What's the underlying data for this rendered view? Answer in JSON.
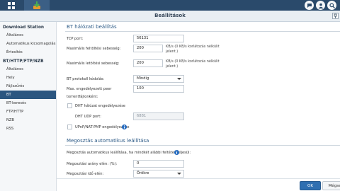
{
  "topbar": {
    "apps": [
      {
        "icon": "main-menu-grid-icon"
      },
      {
        "icon": "download-station-app-icon"
      }
    ],
    "right_icons": [
      "chat-icon",
      "user-icon",
      "search-icon"
    ]
  },
  "window": {
    "title": "Beállítások",
    "pin_icon": "pin-icon"
  },
  "sidebar": {
    "groups": [
      {
        "header": "Download Station",
        "items": [
          {
            "label": "Általános"
          },
          {
            "label": "Automatikus kicsomagolás"
          },
          {
            "label": "Értesítés"
          }
        ]
      },
      {
        "header": "BT/HTTP/FTP/NZB",
        "items": [
          {
            "label": "Általános"
          },
          {
            "label": "Hely"
          },
          {
            "label": "Fájlszűrés"
          },
          {
            "label": "BT",
            "active": true
          },
          {
            "label": "BT-keresés"
          },
          {
            "label": "FTP/HTTP"
          },
          {
            "label": "NZB"
          },
          {
            "label": "RSS"
          }
        ]
      }
    ]
  },
  "bt_section": {
    "title": "BT hálózati beállítás",
    "tcp_port": {
      "label": "TCP port:",
      "value": "56131"
    },
    "upload": {
      "label": "Maximális feltöltési sebesség:",
      "value": "200",
      "hint": "KB/s (0 KB/s korlátozás nélkülit jelent.)"
    },
    "download": {
      "label": "Maximális letöltési sebesség:",
      "value": "200",
      "hint": "KB/s (0 KB/s korlátozás nélkülit jelent.)"
    },
    "protocol": {
      "label": "BT protokoll kódolás:",
      "value": "Mindig"
    },
    "max_peers": {
      "label": "Max. engedélyezett peer",
      "value": "100"
    },
    "torrent_label": "torrentfájlonként:",
    "dht": {
      "label": "DHT hálózat engedélyezése",
      "checked": false
    },
    "dht_port": {
      "label": "DHT UDP port:",
      "value": "6881"
    },
    "upnp": {
      "label": "UPnP/NAT-PMP engedélyezése",
      "checked": false
    }
  },
  "share_section": {
    "title": "Megosztás automatikus leállítása",
    "desc": "Megosztás automatikus leállítása, ha mindkét alábbi feltétel teljesül:",
    "ratio": {
      "label": "Megosztási arány elérı: (%):",
      "value": "0"
    },
    "time": {
      "label": "Megosztási idő elérı:",
      "value": "Örökre"
    }
  },
  "footer": {
    "ok_label": "OK",
    "cancel_label": "Mégse"
  },
  "colors": {
    "topbar": "#2a4a6b",
    "accent": "#2f6fb1",
    "sidebar_active": "#2b5680",
    "section_title": "#2c5a86"
  }
}
